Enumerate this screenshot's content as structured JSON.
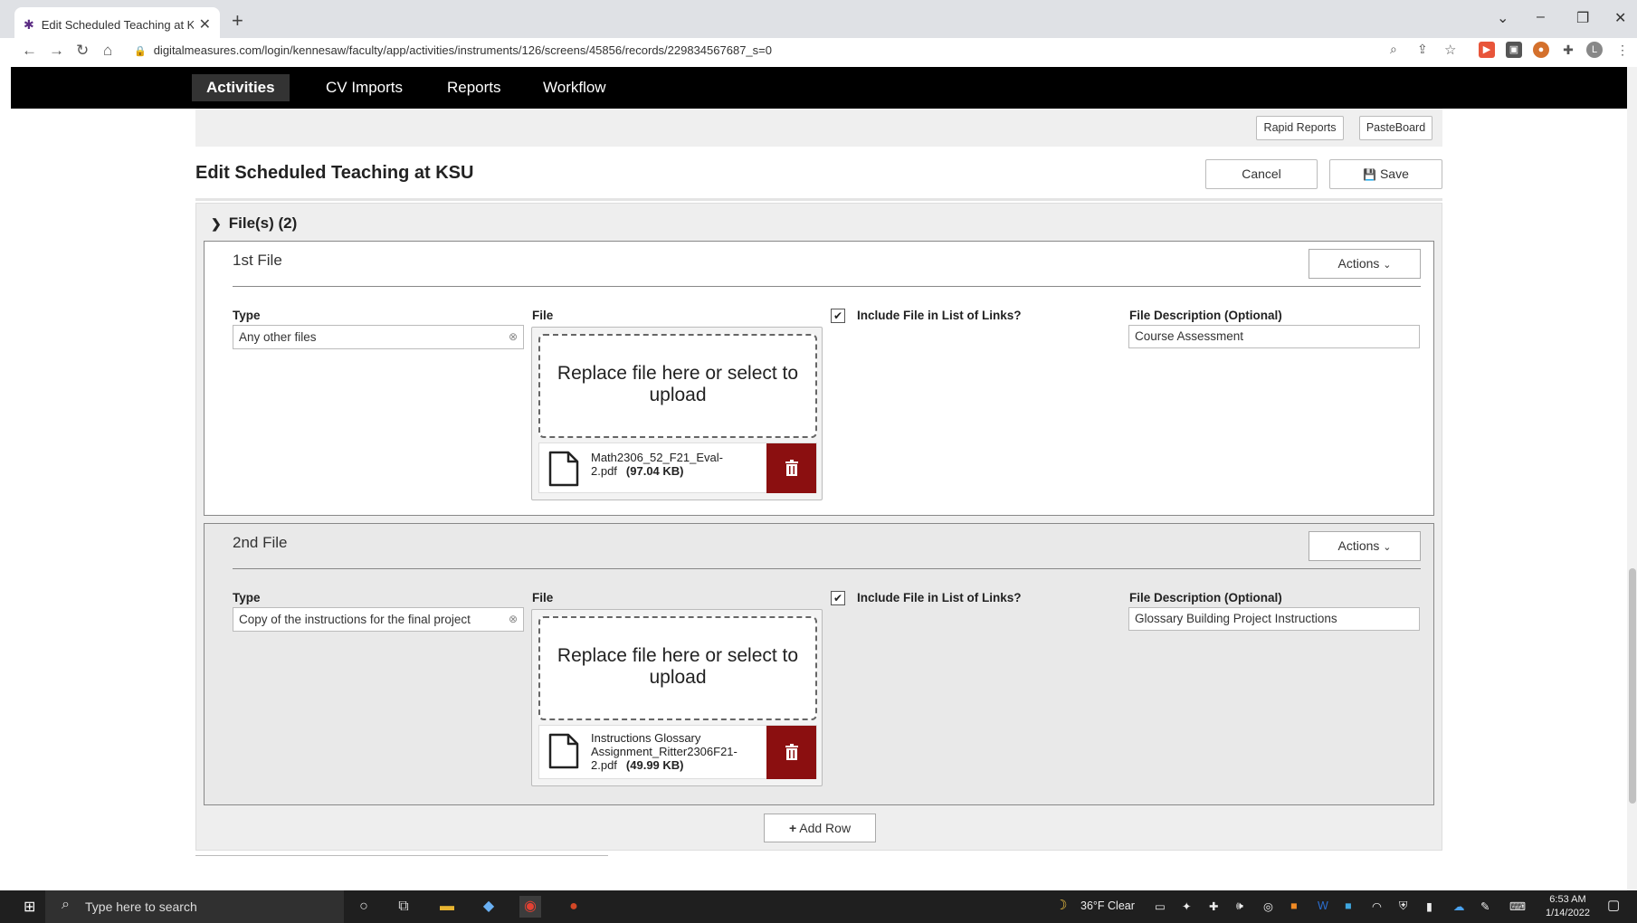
{
  "browser": {
    "tab_title": "Edit Scheduled Teaching at KSU |",
    "url": "digitalmeasures.com/login/kennesaw/faculty/app/activities/instruments/126/screens/45856/records/229834567687_s=0"
  },
  "appnav": {
    "items": [
      "Activities",
      "CV Imports",
      "Reports",
      "Workflow"
    ],
    "active": "Activities"
  },
  "toolbar": {
    "rapid_reports": "Rapid Reports",
    "pasteboard": "PasteBoard",
    "cancel": "Cancel",
    "save": "Save"
  },
  "page": {
    "title": "Edit Scheduled Teaching at KSU",
    "section_label": "File(s) (2)"
  },
  "files": [
    {
      "heading": "1st File",
      "actions": "Actions",
      "type_label": "Type",
      "type_value": "Any other files",
      "file_label": "File",
      "dropzone_text": "Replace file here or select to upload",
      "filename": "Math2306_52_F21_Eval-2.pdf",
      "filesize": "(97.04 KB)",
      "include_label": "Include File in List of Links?",
      "include_checked": true,
      "desc_label": "File Description (Optional)",
      "desc_value": "Course Assessment"
    },
    {
      "heading": "2nd File",
      "actions": "Actions",
      "type_label": "Type",
      "type_value": "Copy of the instructions for the final project",
      "file_label": "File",
      "dropzone_text": "Replace file here or select to upload",
      "filename": "Instructions Glossary Assignment_Ritter2306F21-2.pdf",
      "filesize": "(49.99 KB)",
      "include_label": "Include File in List of Links?",
      "include_checked": true,
      "desc_label": "File Description (Optional)",
      "desc_value": "Glossary Building Project Instructions"
    }
  ],
  "add_row": "Add Row",
  "taskbar": {
    "search_placeholder": "Type here to search",
    "weather": "36°F  Clear",
    "time": "6:53 AM",
    "date": "1/14/2022"
  },
  "colors": {
    "nav_bg": "#000000",
    "trash_bg": "#8b0f10"
  }
}
